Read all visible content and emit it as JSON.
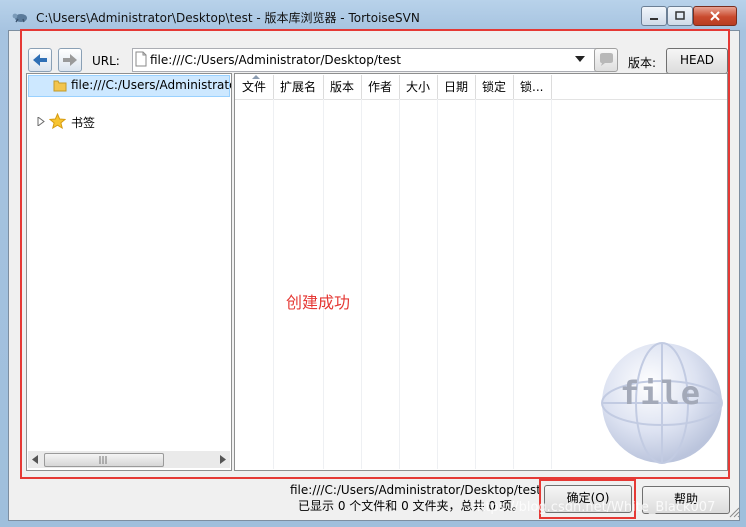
{
  "window": {
    "title": "C:\\Users\\Administrator\\Desktop\\test - 版本库浏览器 - TortoiseSVN"
  },
  "toolbar": {
    "url_label": "URL:",
    "url_value": "file:///C:/Users/Administrator/Desktop/test",
    "version_label": "版本:",
    "version_button": "HEAD"
  },
  "tree": {
    "root_item": "file:///C:/Users/Administrator/",
    "bookmarks_item": "书签"
  },
  "list": {
    "columns": [
      "文件",
      "扩展名",
      "版本",
      "作者",
      "大小",
      "日期",
      "锁定",
      "锁..."
    ]
  },
  "annotation": "创建成功",
  "watermark_logo_text": "file",
  "status": {
    "path": "file:///C:/Users/Administrator/Desktop/test",
    "summary": "已显示 0 个文件和 0 文件夹，总共 0 项。"
  },
  "buttons": {
    "ok": "确定(O)",
    "help": "帮助"
  },
  "watermark": "https://blog.csdn.net/White_Black007",
  "colors": {
    "highlight_red": "#e53935",
    "selection": "#cde8ff"
  }
}
